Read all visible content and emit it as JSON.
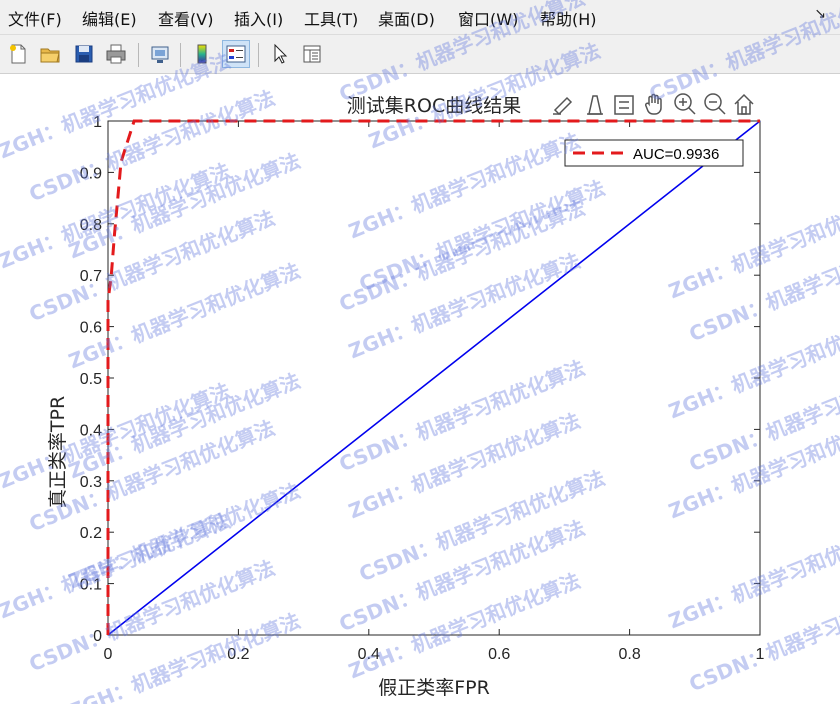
{
  "menu": [
    "文件(F)",
    "编辑(E)",
    "查看(V)",
    "插入(I)",
    "工具(T)",
    "桌面(D)",
    "窗口(W)",
    "帮助(H)"
  ],
  "menu_pin_icon": "↘",
  "toolbar_icons": [
    "new-figure-icon",
    "open-file-icon",
    "save-icon",
    "print-icon",
    "link-plot-icon",
    "insert-colorbar-icon",
    "insert-legend-icon",
    "edit-plot-icon",
    "property-inspector-icon"
  ],
  "axes_toolbar_icons": [
    "brush-icon",
    "data-tips-icon",
    "legend-toggle-icon",
    "pan-icon",
    "zoom-in-icon",
    "zoom-out-icon",
    "home-icon"
  ],
  "watermark": {
    "line1": "ZGH：机器学习和优化算法",
    "line2": "CSDN：机器学习和优化算法"
  },
  "chart_data": {
    "type": "line",
    "title": "测试集ROC曲线结果",
    "xlabel": "假正类率FPR",
    "ylabel": "真正类率TPR",
    "xlim": [
      0,
      1
    ],
    "ylim": [
      0,
      1
    ],
    "xticks": [
      "0",
      "0.2",
      "0.4",
      "0.6",
      "0.8",
      "1"
    ],
    "yticks": [
      "0",
      "0.1",
      "0.2",
      "0.3",
      "0.4",
      "0.5",
      "0.6",
      "0.7",
      "0.8",
      "0.9",
      "1"
    ],
    "grid": false,
    "legend_position": "top-right",
    "series": [
      {
        "name": "AUC=0.9936",
        "color": "#e31a1c",
        "style": "dashed",
        "x": [
          0,
          0,
          0.005,
          0.01,
          0.015,
          0.02,
          0.04,
          1
        ],
        "y": [
          0,
          0.65,
          0.7,
          0.78,
          0.85,
          0.92,
          1.0,
          1.0
        ]
      },
      {
        "name": "",
        "color": "#0000ee",
        "style": "solid",
        "x": [
          0,
          1
        ],
        "y": [
          0,
          1
        ]
      }
    ]
  }
}
